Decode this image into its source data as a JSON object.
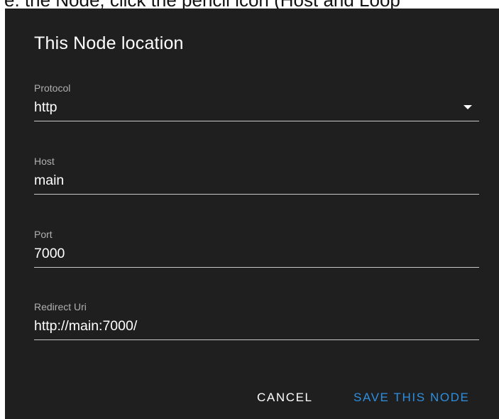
{
  "background_caption": "e. the Node, click the pencil icon (Host and Loop",
  "dialog": {
    "title": "This Node location",
    "fields": [
      {
        "label": "Protocol",
        "value": "http",
        "type": "select"
      },
      {
        "label": "Host",
        "value": "main",
        "type": "text"
      },
      {
        "label": "Port",
        "value": "7000",
        "type": "text"
      },
      {
        "label": "Redirect Uri",
        "value": "http://main:7000/",
        "type": "text"
      }
    ],
    "actions": {
      "cancel_label": "CANCEL",
      "save_label": "SAVE THIS NODE"
    }
  },
  "colors": {
    "dialog_bg": "#1f1f1f",
    "accent": "#2d8fe0",
    "text": "#ffffff",
    "label": "#b0b0b0"
  },
  "icons": {
    "protocol_dropdown": "caret-down-icon"
  }
}
